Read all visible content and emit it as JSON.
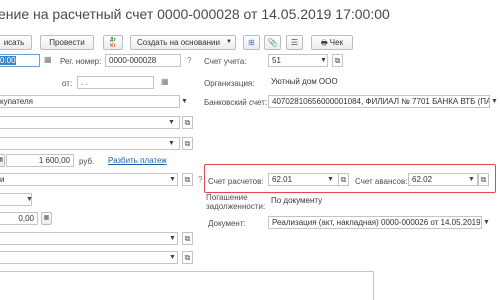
{
  "window": {
    "title": "ение на расчетный счет 0000-000028 от 14.05.2019 17:00:00"
  },
  "toolbar": {
    "post_close_label": "исать",
    "post_label": "Провести",
    "dt_kt_label": "Дт Кт",
    "create_based_label": "Создать на основании",
    "check_label": "Чек"
  },
  "form": {
    "date_value": "0:00",
    "reg_number_label": "Рег. номер:",
    "reg_number_value": "0000-000028",
    "from_label": "от:",
    "from_value": ". .",
    "account_label": "Счет учета:",
    "account_value": "51",
    "org_label": "Организация:",
    "org_value": "Уютный дом ООО",
    "payer_value": "купателя",
    "bank_account_label": "Банковский счет:",
    "bank_account_value": "40702810656000001084, ФИЛИАЛ № 7701 БАНКА ВТБ (ПА",
    "amount_value": "1 600,00",
    "currency_label": "руб.",
    "split_payment_link": "Разбить платеж",
    "settlement_type_value": "и",
    "settlement_account_label": "Счет расчетов:",
    "settlement_account_value": "62.01",
    "advance_account_label": "Счет авансов:",
    "advance_account_value": "62.02",
    "debt_repayment_label_1": "Погашение",
    "debt_repayment_label_2": "задолженности:",
    "debt_repayment_value": "По документу",
    "vat_amount_value": "0,00",
    "document_label": "Документ:",
    "document_value": "Реализация (акт, накладная) 0000-000026 от 14.05.2019"
  }
}
